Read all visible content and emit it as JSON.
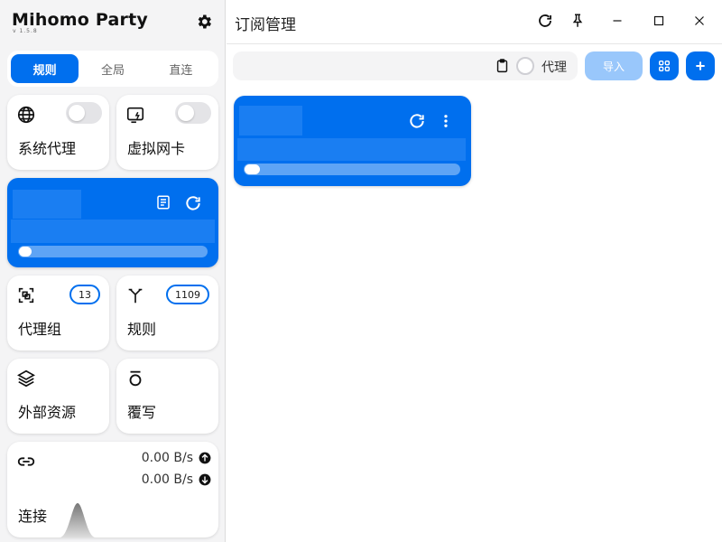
{
  "app": {
    "title": "Mihomo Party",
    "subtitle": "v 1.5.8"
  },
  "mode_tabs": [
    {
      "label": "规则",
      "active": true
    },
    {
      "label": "全局",
      "active": false
    },
    {
      "label": "直连",
      "active": false
    }
  ],
  "cards": {
    "system_proxy": {
      "label": "系统代理",
      "icon": "globe-icon",
      "enabled": false
    },
    "tun": {
      "label": "虚拟网卡",
      "icon": "tun-icon",
      "enabled": false
    },
    "proxy_groups": {
      "label": "代理组",
      "count": "13",
      "icon": "scan-icon"
    },
    "rules": {
      "label": "规则",
      "count": "1109",
      "icon": "fork-icon"
    },
    "resources": {
      "label": "外部资源",
      "icon": "layers-icon"
    },
    "override": {
      "label": "覆写",
      "icon": "override-icon"
    },
    "connections": {
      "label": "连接",
      "upload": "0.00 B/s",
      "download": "0.00 B/s",
      "icon": "link-icon"
    }
  },
  "profile_card": {
    "progress": 0.06
  },
  "main": {
    "title": "订阅管理",
    "url_placeholder": "",
    "proxy_label": "代理",
    "import_label": "导入"
  },
  "subscription_card": {
    "progress": 0.07
  },
  "colors": {
    "accent": "#006fee",
    "sidebar_bg": "#f4f4f5",
    "import_disabled": "#99c7fb"
  }
}
